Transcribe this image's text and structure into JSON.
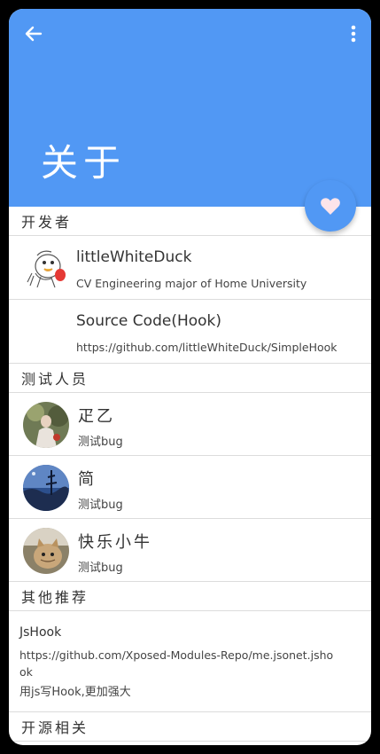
{
  "appbar": {
    "title": "关于",
    "back_icon": "arrow-left-icon",
    "more_icon": "more-vert-icon",
    "color": "#5198f4"
  },
  "fab": {
    "icon": "heart-icon",
    "icon_color": "#fde4ea"
  },
  "sections": {
    "developer": "开发者",
    "testers": "测试人员",
    "recommend": "其他推荐",
    "opensource": "开源相关"
  },
  "developer": {
    "name": "littleWhiteDuck",
    "desc": "CV Engineering major of Home University"
  },
  "source": {
    "title": "Source Code(Hook)",
    "url": "https://github.com/littleWhiteDuck/SimpleHook"
  },
  "testers": [
    {
      "name": "疋乙",
      "desc": "测试bug"
    },
    {
      "name": "简",
      "desc": "测试bug"
    },
    {
      "name": "快乐小牛",
      "desc": "测试bug"
    }
  ],
  "recommend": {
    "title": "JsHook",
    "url": "https://github.com/Xposed-Modules-Repo/me.jsonet.jshook",
    "desc": "用js写Hook,更加强大"
  }
}
